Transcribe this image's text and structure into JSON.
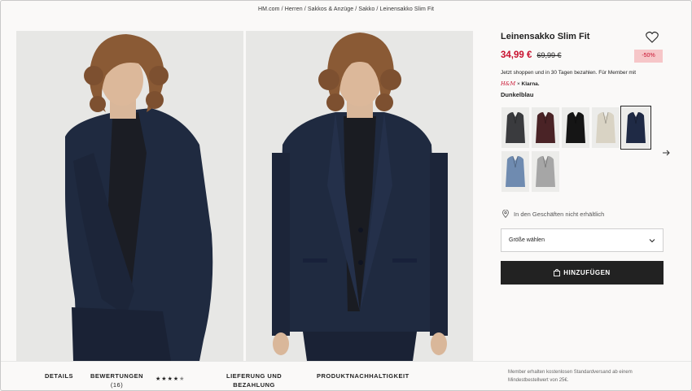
{
  "breadcrumb": "HM.com / Herren / Sakkos & Anzüge / Sakko / Leinensakko Slim Fit",
  "product": {
    "title": "Leinensakko Slim Fit",
    "price_sale": "34,99 €",
    "price_old": "69,99 €",
    "discount": "-50%",
    "klarna_text": "Jetzt shoppen und in 30 Tagen bezahlen. Für Member mit",
    "klarna_brand_hm": "H&M",
    "klarna_x": "×",
    "klarna_brand": "Klarna.",
    "color_name": "Dunkelblau",
    "store_availability": "In den Geschäften nicht erhältlich",
    "size_placeholder": "Größe wählen",
    "add_button": "HINZUFÜGEN"
  },
  "swatches": [
    {
      "color": "#3a3b3e"
    },
    {
      "color": "#4a2326"
    },
    {
      "color": "#151515"
    },
    {
      "color": "#d9d3c4"
    },
    {
      "color": "#1f2a45",
      "selected": true
    },
    {
      "color": "#6f8bb0"
    },
    {
      "color": "#a6a6a6"
    }
  ],
  "bottom_tabs": {
    "details": "DETAILS",
    "reviews": "BEWERTUNGEN",
    "reviews_count": "(16)",
    "rating_stars": 4.5,
    "delivery_line1": "LIEFERUNG UND",
    "delivery_line2": "BEZAHLUNG",
    "sustainability": "PRODUKTNACHHALTIGKEIT",
    "member_note": "Member erhalten kostenlosen Standardversand ab einem Mindestbestellwert von 25€."
  },
  "colors": {
    "sale_red": "#c8102e",
    "discount_bg": "#f6c6c8",
    "button_bg": "#222222",
    "page_bg": "#faf9f8"
  }
}
